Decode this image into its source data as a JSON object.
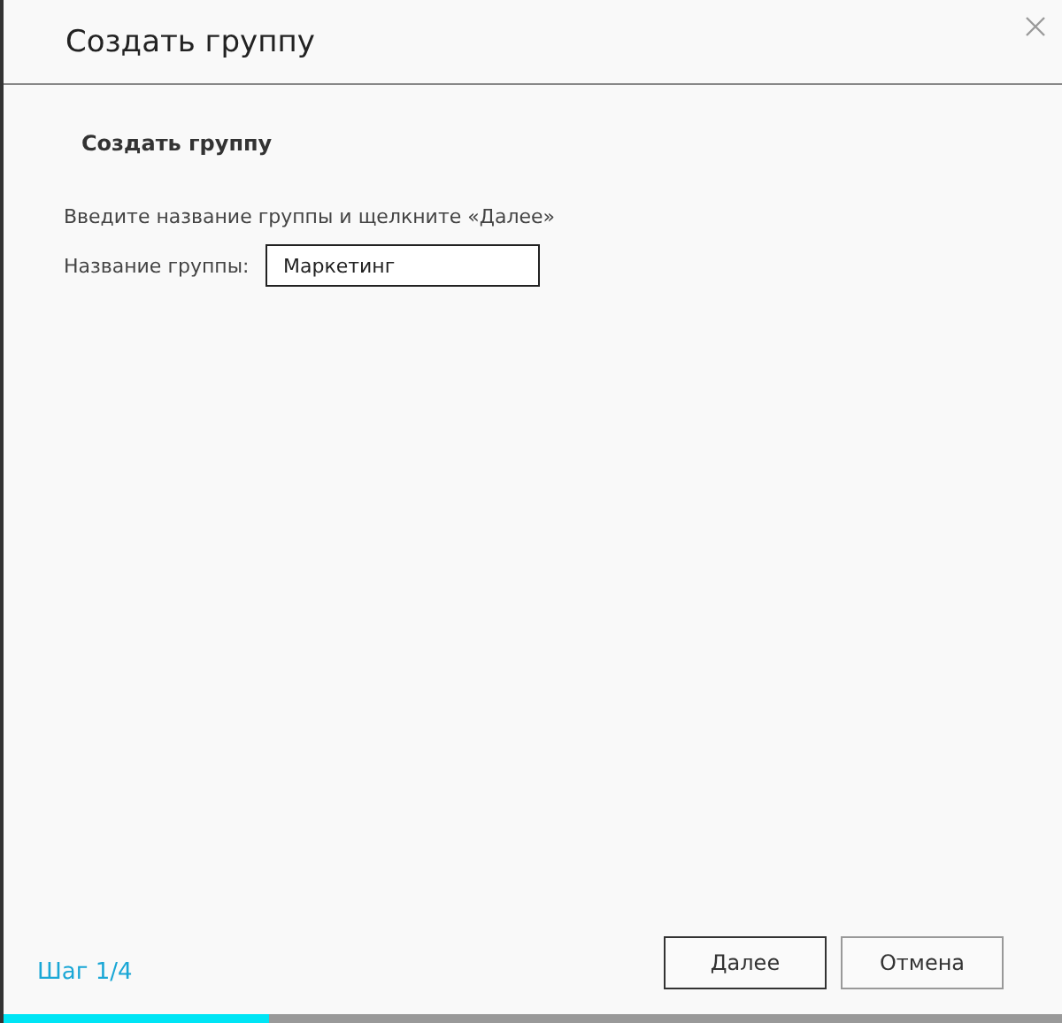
{
  "window": {
    "title": "Создать группу"
  },
  "section_title": "Создать группу",
  "instruction": "Введите название группы и щелкните «Далее»",
  "field": {
    "label": "Название группы:",
    "value": "Маркетинг"
  },
  "step": "Шаг 1/4",
  "buttons": [
    {
      "label": "Далее",
      "primary": true
    },
    {
      "label": "Отмена",
      "primary": false
    }
  ],
  "progress": {
    "level": 0.25
  }
}
